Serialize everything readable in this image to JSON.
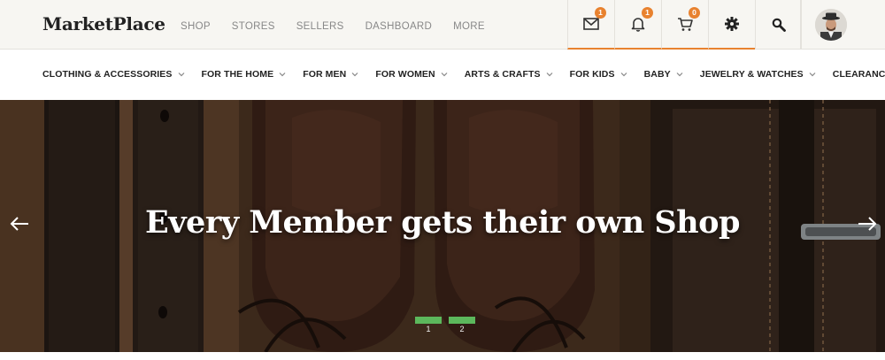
{
  "header": {
    "logo": "MarketPlace",
    "nav": [
      "SHOP",
      "STORES",
      "SELLERS",
      "DASHBOARD",
      "MORE"
    ],
    "icons": {
      "messages": {
        "icon": "envelope-icon",
        "count": "1"
      },
      "notifications": {
        "icon": "bell-icon",
        "count": "1"
      },
      "cart": {
        "icon": "cart-icon",
        "count": "0"
      },
      "settings": {
        "icon": "gear-icon"
      },
      "search": {
        "icon": "search-icon"
      }
    },
    "accent_color": "#e8822f"
  },
  "categories": [
    "CLOTHING & ACCESSORIES",
    "FOR THE HOME",
    "FOR MEN",
    "FOR WOMEN",
    "ARTS & CRAFTS",
    "FOR KIDS",
    "BABY",
    "JEWELRY & WATCHES",
    "CLEARANCE"
  ],
  "hero": {
    "title": "Every Member gets their own Shop",
    "slides": [
      "1",
      "2"
    ],
    "indicator_color": "#5cb85c"
  }
}
